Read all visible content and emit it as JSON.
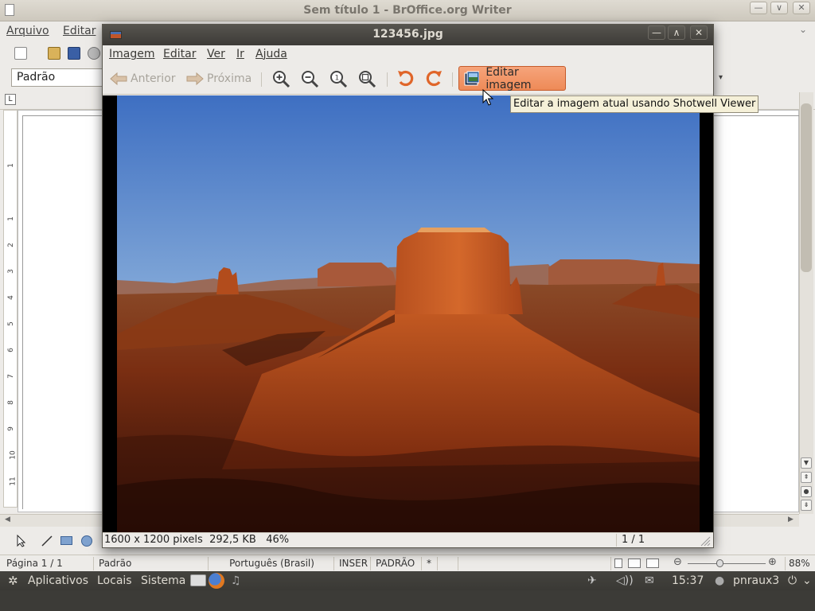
{
  "writer": {
    "title": "Sem título 1 - BrOffice.org Writer",
    "menu": [
      "Arquivo",
      "Editar"
    ],
    "paragraph_style": "Padrão",
    "ruler_numbers": [
      "1",
      "1",
      "2",
      "3",
      "4",
      "5",
      "6",
      "7",
      "8",
      "9",
      "10",
      "11"
    ],
    "status": {
      "page": "Página 1 / 1",
      "style": "Padrão",
      "language": "Português (Brasil)",
      "insert": "INSER",
      "selection": "PADRÃO",
      "modified": "*",
      "zoom": "88%"
    }
  },
  "viewer": {
    "title": "123456.jpg",
    "menu": [
      "Imagem",
      "Editar",
      "Ver",
      "Ir",
      "Ajuda"
    ],
    "toolbar": {
      "prev": "Anterior",
      "next": "Próxima",
      "edit": "Editar imagem"
    },
    "tooltip": "Editar a imagem atual usando Shotwell Viewer",
    "status": {
      "info": "1600 x 1200 pixels  292,5 KB   46%",
      "position": "1 / 1"
    }
  },
  "panel": {
    "apps": "Aplicativos",
    "places": "Locais",
    "system": "Sistema",
    "clock": "15:37",
    "user": "pnraux3"
  },
  "colors": {
    "viewer_titlebar": "#3d3b37",
    "edit_button": "#ee8a57",
    "panel": "#3c3b37"
  }
}
